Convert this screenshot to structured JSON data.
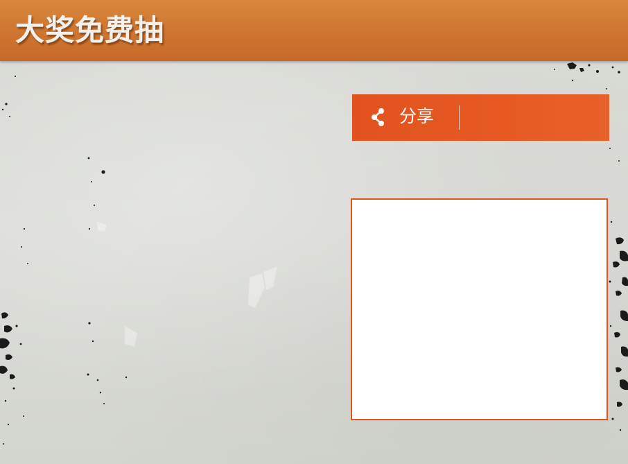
{
  "header": {
    "title": "大奖免费抽"
  },
  "share": {
    "label": "分享",
    "icon": "share-icon"
  },
  "colors": {
    "header_orange": "#cf7630",
    "accent_orange": "#e2521f",
    "background": "#d8d9d4",
    "panel": "#ffffff"
  }
}
